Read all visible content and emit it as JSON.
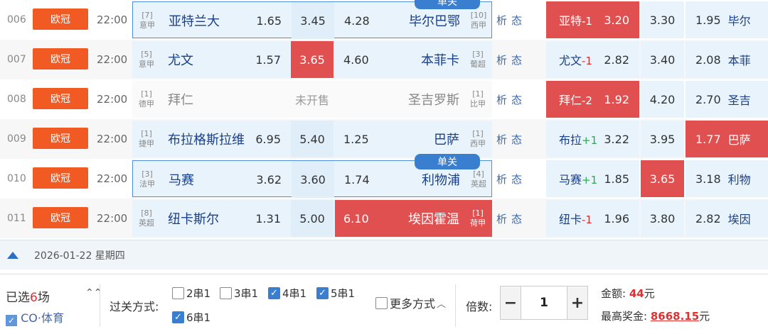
{
  "matches": [
    {
      "num": "006",
      "league": "欧冠",
      "time": "22:00",
      "single_badge": "单关",
      "home": {
        "rank": "[7]",
        "league": "意甲",
        "name": "亚特兰大",
        "odd": "1.65"
      },
      "draw": "3.45",
      "away": {
        "rank": "[10]",
        "league": "西甲",
        "name": "毕尔巴鄂",
        "odd": "4.28"
      },
      "analysis": [
        "析",
        "态"
      ],
      "handicap": {
        "team": "亚特",
        "line": "-1",
        "odd": "3.20",
        "draw": "3.30",
        "away_odd": "1.95",
        "away_team": "毕尔"
      }
    },
    {
      "num": "007",
      "league": "欧冠",
      "time": "22:00",
      "single_badge": "",
      "home": {
        "rank": "[5]",
        "league": "意甲",
        "name": "尤文",
        "odd": "1.57"
      },
      "draw": "3.65",
      "away": {
        "rank": "[3]",
        "league": "葡超",
        "name": "本菲卡",
        "odd": "4.60"
      },
      "analysis": [
        "析",
        "态"
      ],
      "handicap": {
        "team": "尤文",
        "line": "-1",
        "odd": "2.82",
        "draw": "3.40",
        "away_odd": "2.08",
        "away_team": "本菲"
      }
    },
    {
      "num": "008",
      "league": "欧冠",
      "time": "22:00",
      "single_badge": "",
      "home": {
        "rank": "[1]",
        "league": "德甲",
        "name": "拜仁",
        "odd": ""
      },
      "draw": "未开售",
      "away": {
        "rank": "[1]",
        "league": "比甲",
        "name": "圣吉罗斯",
        "odd": ""
      },
      "analysis": [
        "析",
        "态"
      ],
      "handicap": {
        "team": "拜仁",
        "line": "-2",
        "odd": "1.92",
        "draw": "4.20",
        "away_odd": "2.70",
        "away_team": "圣吉"
      }
    },
    {
      "num": "009",
      "league": "欧冠",
      "time": "22:00",
      "single_badge": "",
      "home": {
        "rank": "[1]",
        "league": "捷甲",
        "name": "布拉格斯拉维",
        "odd": "6.95"
      },
      "draw": "5.40",
      "away": {
        "rank": "[1]",
        "league": "西甲",
        "name": "巴萨",
        "odd": "1.25"
      },
      "analysis": [
        "析",
        "态"
      ],
      "handicap": {
        "team": "布拉",
        "line": "+1",
        "odd": "3.22",
        "draw": "3.95",
        "away_odd": "1.77",
        "away_team": "巴萨"
      }
    },
    {
      "num": "010",
      "league": "欧冠",
      "time": "22:00",
      "single_badge": "单关",
      "home": {
        "rank": "[3]",
        "league": "法甲",
        "name": "马赛",
        "odd": "3.62"
      },
      "draw": "3.60",
      "away": {
        "rank": "[4]",
        "league": "英超",
        "name": "利物浦",
        "odd": "1.74"
      },
      "analysis": [
        "析",
        "态"
      ],
      "handicap": {
        "team": "马赛",
        "line": "+1",
        "odd": "1.85",
        "draw": "3.65",
        "away_odd": "3.18",
        "away_team": "利物"
      }
    },
    {
      "num": "011",
      "league": "欧冠",
      "time": "22:00",
      "single_badge": "",
      "home": {
        "rank": "[8]",
        "league": "英超",
        "name": "纽卡斯尔",
        "odd": "1.31"
      },
      "draw": "5.00",
      "away": {
        "rank": "[1]",
        "league": "荷甲",
        "name": "埃因霍温",
        "odd": "6.10"
      },
      "analysis": [
        "析",
        "态"
      ],
      "handicap": {
        "team": "纽卡",
        "line": "-1",
        "odd": "1.96",
        "draw": "3.80",
        "away_odd": "2.82",
        "away_team": "埃因"
      }
    }
  ],
  "date_bar": {
    "date": "2026-01-22 星期四"
  },
  "footer": {
    "selected_prefix": "已选",
    "selected_count": "6",
    "selected_suffix": "场",
    "chevron": "⌃⌃",
    "watermark": "CO·体育",
    "parlay_label": "过关方式:",
    "options": [
      {
        "label": "2串1",
        "checked": false
      },
      {
        "label": "3串1",
        "checked": false
      },
      {
        "label": "4串1",
        "checked": true
      },
      {
        "label": "5串1",
        "checked": true
      },
      {
        "label": "6串1",
        "checked": true
      }
    ],
    "more_label": "更多方式",
    "multiplier_label": "倍数:",
    "multiplier_value": "1",
    "minus": "−",
    "plus": "+",
    "amount_label": "金额:",
    "amount_value": "44",
    "amount_unit": "元",
    "prize_label": "最高奖金:",
    "prize_value": "8668.15",
    "prize_unit": "元"
  }
}
